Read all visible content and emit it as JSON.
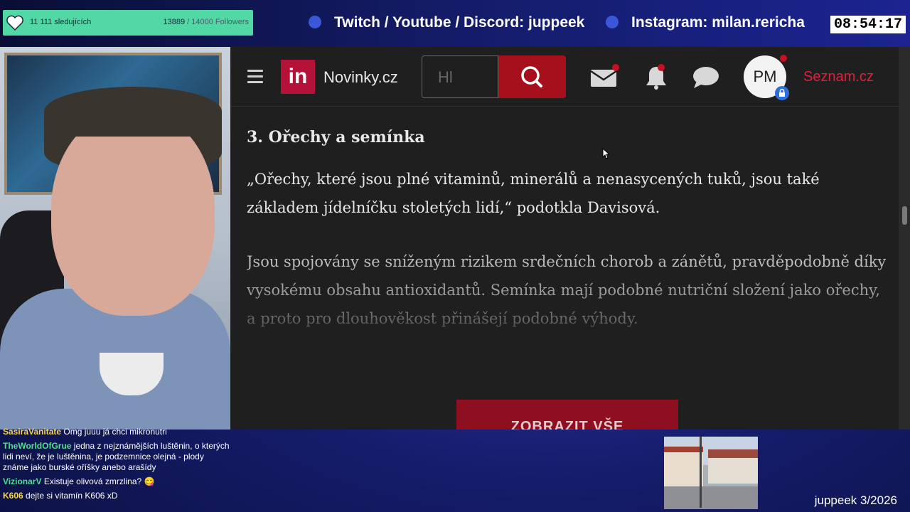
{
  "overlay": {
    "followers": {
      "subtitle": "11 111 sledujících",
      "current": "13889",
      "goal": "/ 14000 Followers",
      "progress_fraction": 0.992
    },
    "social_links": [
      {
        "icon": "twitch-icon",
        "label": "Twitch / Youtube / Discord: juppeek"
      },
      {
        "icon": "instagram-icon",
        "label": "Instagram: milan.rericha"
      }
    ],
    "clock": "08:54:17",
    "signature": "juppeek 3/2026"
  },
  "browser": {
    "site_name": "Novinky.cz",
    "logo_text": "in",
    "search": {
      "placeholder": "Hl",
      "button_icon": "search-icon"
    },
    "avatar_initials": "PM",
    "seznam_link": "Seznam.cz",
    "accent_color": "#b5123a"
  },
  "article": {
    "heading": "3. Ořechy a semínka",
    "quote": "„Ořechy, které jsou plné vitaminů, minerálů a nenasycených tuků, jsou také základem jídelníčku stoletých lidí,“ podotkla Davisová.",
    "paragraph": "Jsou spojovány se sníženým rizikem srdečních chorob a zánětů, pravděpodobně díky vysokému obsahu antioxidantů. Semínka mají podobné nutriční složení jako ořechy, a proto pro dlouhověkost přinášejí podobné výhody.",
    "show_all_button": "ZOBRAZIT VŠE"
  },
  "chat": [
    {
      "user": "SasiraVanitate",
      "color": "#f7d54a",
      "text": "Omg juuu já chci mikronutri"
    },
    {
      "user": "TheWorldOfGrue",
      "color": "#4ee08e",
      "text": "jedna z nejznámějších luštěnin, o kterých lidi neví, že je luštěnina, je podzemnice olejná - plody známe jako burské oříšky anebo arašídy"
    },
    {
      "user": "VizionarV",
      "color": "#4ee08e",
      "text": "Existuje olivová zmrzlina? 😋"
    },
    {
      "user": "K606",
      "color": "#f7d54a",
      "text": "dejte si vitamín K606 xD"
    }
  ]
}
